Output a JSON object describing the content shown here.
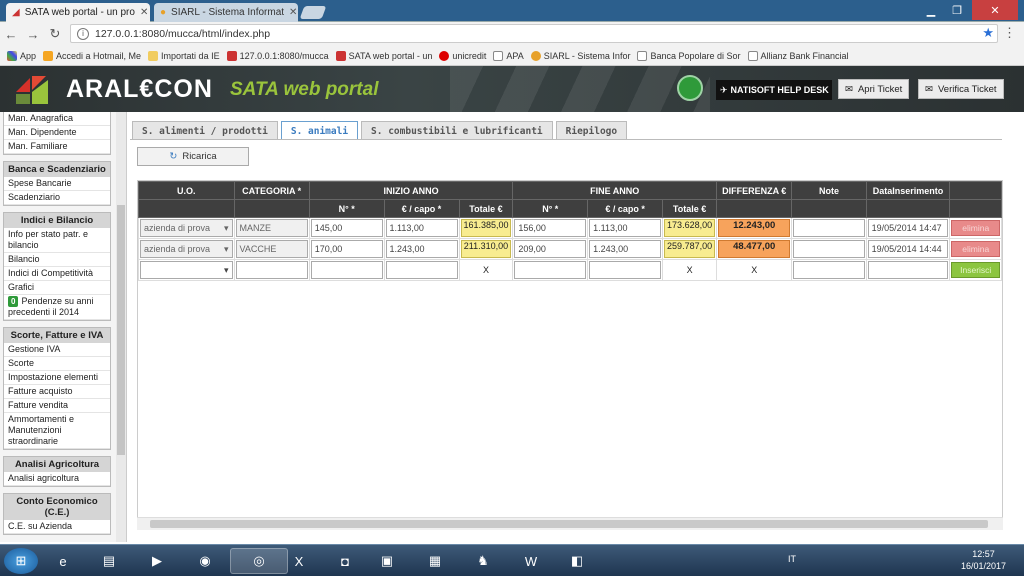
{
  "browser": {
    "tabs": [
      {
        "title": "SATA web portal - un pro",
        "active": true
      },
      {
        "title": "SIARL - Sistema Informat",
        "active": false
      }
    ],
    "url": "127.0.0.1:8080/mucca/html/index.php",
    "bookmarks": [
      "App",
      "Accedi a Hotmail, Me",
      "Importati da IE",
      "127.0.0.1:8080/mucca",
      "SATA web portal - un",
      "unicredit",
      "APA",
      "SIARL - Sistema Infor",
      "Banca Popolare di Sor",
      "Allianz Bank Financial"
    ]
  },
  "header": {
    "brand": "ARAL€CON",
    "portal": "SATA web portal",
    "helpdesk": "NATISOFT HELP DESK",
    "apri_ticket": "Apri Ticket",
    "verifica_ticket": "Verifica Ticket"
  },
  "sidebar": {
    "top_items": [
      "Man. Anagrafica",
      "Man. Dipendente",
      "Man. Familiare"
    ],
    "groups": [
      {
        "title": "Banca e Scadenziario",
        "items": [
          "Spese Bancarie",
          "Scadenziario"
        ]
      },
      {
        "title": "Indici e Bilancio",
        "items": [
          "Info per stato patr. e bilancio",
          "Bilancio",
          "Indici di Competitività",
          "Grafici"
        ],
        "badge_item": {
          "badge": "0",
          "label": "Pendenze su anni precedenti il 2014"
        }
      },
      {
        "title": "Scorte, Fatture e IVA",
        "items": [
          "Gestione IVA",
          "Scorte",
          "Impostazione elementi",
          "Fatture acquisto",
          "Fatture vendita",
          "Ammortamenti e Manutenzioni straordinarie"
        ]
      },
      {
        "title": "Analisi Agricoltura",
        "items": [
          "Analisi agricoltura"
        ]
      },
      {
        "title": "Conto Economico (C.E.)",
        "items": [
          "C.E. su Azienda"
        ]
      }
    ]
  },
  "page_tabs": [
    "S. alimenti / prodotti",
    "S. animali",
    "S. combustibili e lubrificanti",
    "Riepilogo"
  ],
  "ricarica": "Ricarica",
  "table": {
    "group_headers": {
      "uo": "U.O.",
      "categoria": "CATEGORIA *",
      "inizio": "INIZIO ANNO",
      "fine": "FINE ANNO",
      "differenza": "DIFFERENZA €",
      "note": "Note",
      "data": "DataInserimento"
    },
    "sub_headers": {
      "n": "N° *",
      "capo": "€ / capo *",
      "totale": "Totale €"
    },
    "rows": [
      {
        "uo": "azienda di prova",
        "categoria": "MANZE",
        "inizio_n": "145,00",
        "inizio_capo": "1.113,00",
        "inizio_tot": "161.385,00",
        "fine_n": "156,00",
        "fine_capo": "1.113,00",
        "fine_tot": "173.628,00",
        "diff": "12.243,00",
        "note": "",
        "data": "19/05/2014 14:47",
        "action": "elimina"
      },
      {
        "uo": "azienda di prova",
        "categoria": "VACCHE",
        "inizio_n": "170,00",
        "inizio_capo": "1.243,00",
        "inizio_tot": "211.310,00",
        "fine_n": "209,00",
        "fine_capo": "1.243,00",
        "fine_tot": "259.787,00",
        "diff": "48.477,00",
        "note": "",
        "data": "19/05/2014 14:44",
        "action": "elimina"
      }
    ],
    "new_row": {
      "x1": "X",
      "x2": "X",
      "x3": "X",
      "action": "Inserisci"
    }
  },
  "taskbar": {
    "lang": "IT",
    "time": "12:57",
    "date": "16/01/2017"
  }
}
